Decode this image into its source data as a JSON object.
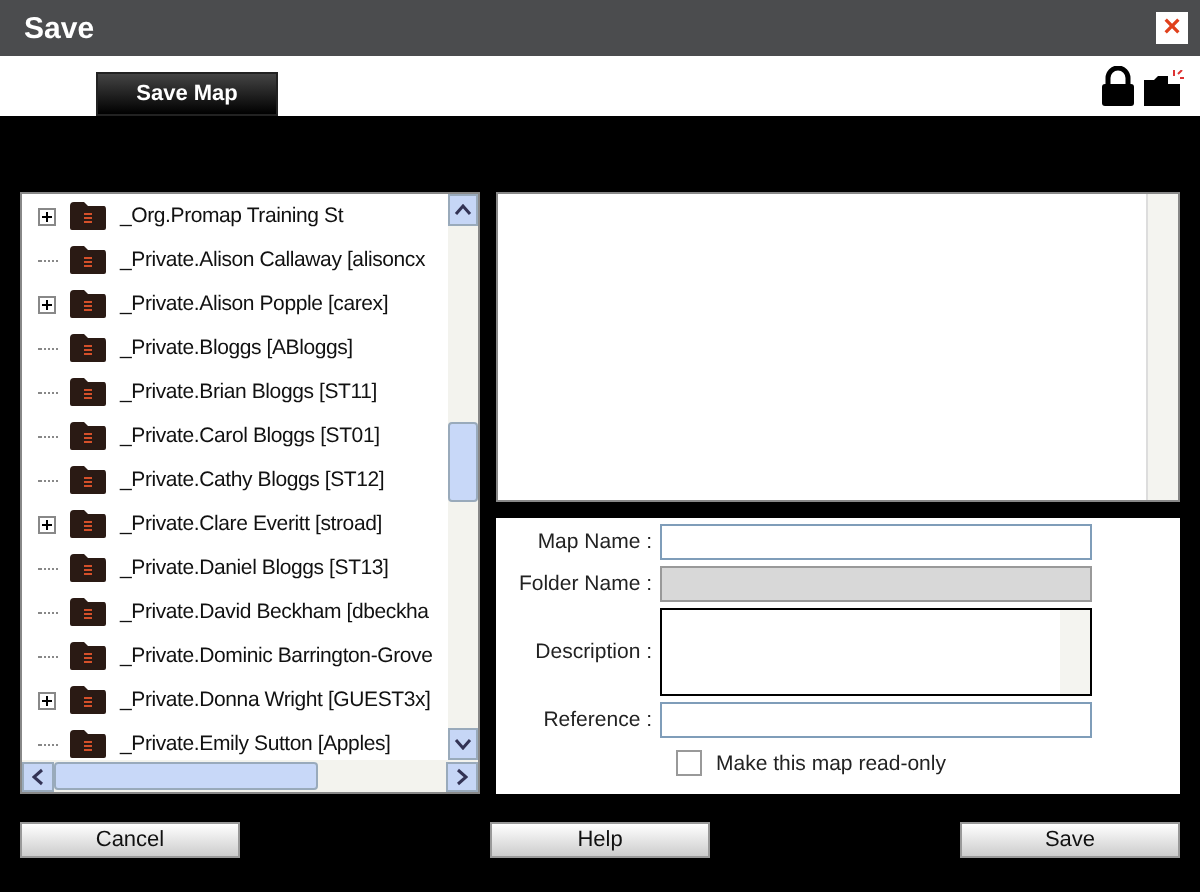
{
  "window": {
    "title": "Save",
    "close": "×"
  },
  "toolbar": {
    "save_map": "Save Map"
  },
  "tree": {
    "items": [
      {
        "label": "_Org.Promap Training St",
        "expandable": true
      },
      {
        "label": "_Private.Alison Callaway [alisoncx",
        "expandable": false
      },
      {
        "label": "_Private.Alison Popple [carex]",
        "expandable": true
      },
      {
        "label": "_Private.Bloggs [ABloggs]",
        "expandable": false
      },
      {
        "label": "_Private.Brian Bloggs [ST11]",
        "expandable": false
      },
      {
        "label": "_Private.Carol Bloggs [ST01]",
        "expandable": false
      },
      {
        "label": "_Private.Cathy Bloggs [ST12]",
        "expandable": false
      },
      {
        "label": "_Private.Clare Everitt [stroad]",
        "expandable": true
      },
      {
        "label": "_Private.Daniel Bloggs [ST13]",
        "expandable": false
      },
      {
        "label": "_Private.David Beckham [dbeckha",
        "expandable": false
      },
      {
        "label": "_Private.Dominic Barrington-Grove",
        "expandable": false
      },
      {
        "label": "_Private.Donna Wright [GUEST3x]",
        "expandable": true
      },
      {
        "label": "_Private.Emily Sutton [Apples]",
        "expandable": false
      }
    ]
  },
  "form": {
    "fields": [
      {
        "kind": "text",
        "label": "Map Name :",
        "disabled": false
      },
      {
        "kind": "text",
        "label": "Folder Name :",
        "disabled": true
      },
      {
        "kind": "textarea",
        "label": "Description :",
        "disabled": false
      },
      {
        "kind": "text",
        "label": "Reference :",
        "disabled": false
      }
    ],
    "read_only": {
      "label": "Make this map read-only",
      "checked": false
    }
  },
  "buttons": [
    "Cancel",
    "Help",
    "Save"
  ]
}
